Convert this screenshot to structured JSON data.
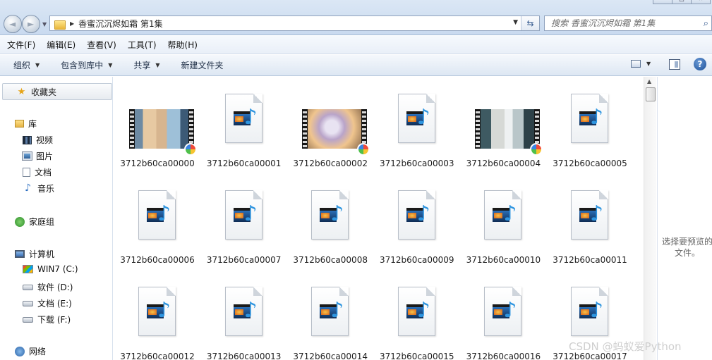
{
  "window": {
    "controls": [
      "—",
      "□",
      "✕"
    ]
  },
  "nav": {
    "back_glyph": "◄",
    "forward_glyph": "►",
    "address_separator": "▶",
    "address_path": "香蜜沉沉烬如霜 第1集",
    "search_placeholder": "搜索 香蜜沉沉烬如霜 第1集"
  },
  "menu": [
    "文件(F)",
    "编辑(E)",
    "查看(V)",
    "工具(T)",
    "帮助(H)"
  ],
  "toolbar": {
    "organize": "组织",
    "include_in_library": "包含到库中",
    "share": "共享",
    "new_folder": "新建文件夹",
    "help": "?"
  },
  "sidebar": {
    "favorites": "收藏夹",
    "libraries": "库",
    "videos": "视频",
    "pictures": "图片",
    "documents": "文档",
    "music": "音乐",
    "homegroup": "家庭组",
    "computer": "计算机",
    "drive_c": "WIN7 (C:)",
    "drive_d": "软件 (D:)",
    "drive_e": "文档 (E:)",
    "drive_f": "下载 (F:)",
    "network": "网络"
  },
  "files": [
    {
      "name": "3712b60ca00000",
      "kind": "video-thumbnail"
    },
    {
      "name": "3712b60ca00001",
      "kind": "media-file"
    },
    {
      "name": "3712b60ca00002",
      "kind": "video-thumbnail"
    },
    {
      "name": "3712b60ca00003",
      "kind": "media-file"
    },
    {
      "name": "3712b60ca00004",
      "kind": "video-thumbnail"
    },
    {
      "name": "3712b60ca00005",
      "kind": "media-file"
    },
    {
      "name": "3712b60ca00006",
      "kind": "media-file"
    },
    {
      "name": "3712b60ca00007",
      "kind": "media-file"
    },
    {
      "name": "3712b60ca00008",
      "kind": "media-file"
    },
    {
      "name": "3712b60ca00009",
      "kind": "media-file"
    },
    {
      "name": "3712b60ca00010",
      "kind": "media-file"
    },
    {
      "name": "3712b60ca00011",
      "kind": "media-file"
    },
    {
      "name": "3712b60ca00012",
      "kind": "media-file"
    },
    {
      "name": "3712b60ca00013",
      "kind": "media-file"
    },
    {
      "name": "3712b60ca00014",
      "kind": "media-file"
    },
    {
      "name": "3712b60ca00015",
      "kind": "media-file"
    },
    {
      "name": "3712b60ca00016",
      "kind": "media-file"
    },
    {
      "name": "3712b60ca00017",
      "kind": "media-file"
    }
  ],
  "preview": {
    "message": "选择要预览的文件。"
  },
  "watermark": "CSDN @蚂蚁爱Python",
  "colors": {
    "accent": "#3a5e92",
    "toolbar_bg": "#dde7f3"
  }
}
